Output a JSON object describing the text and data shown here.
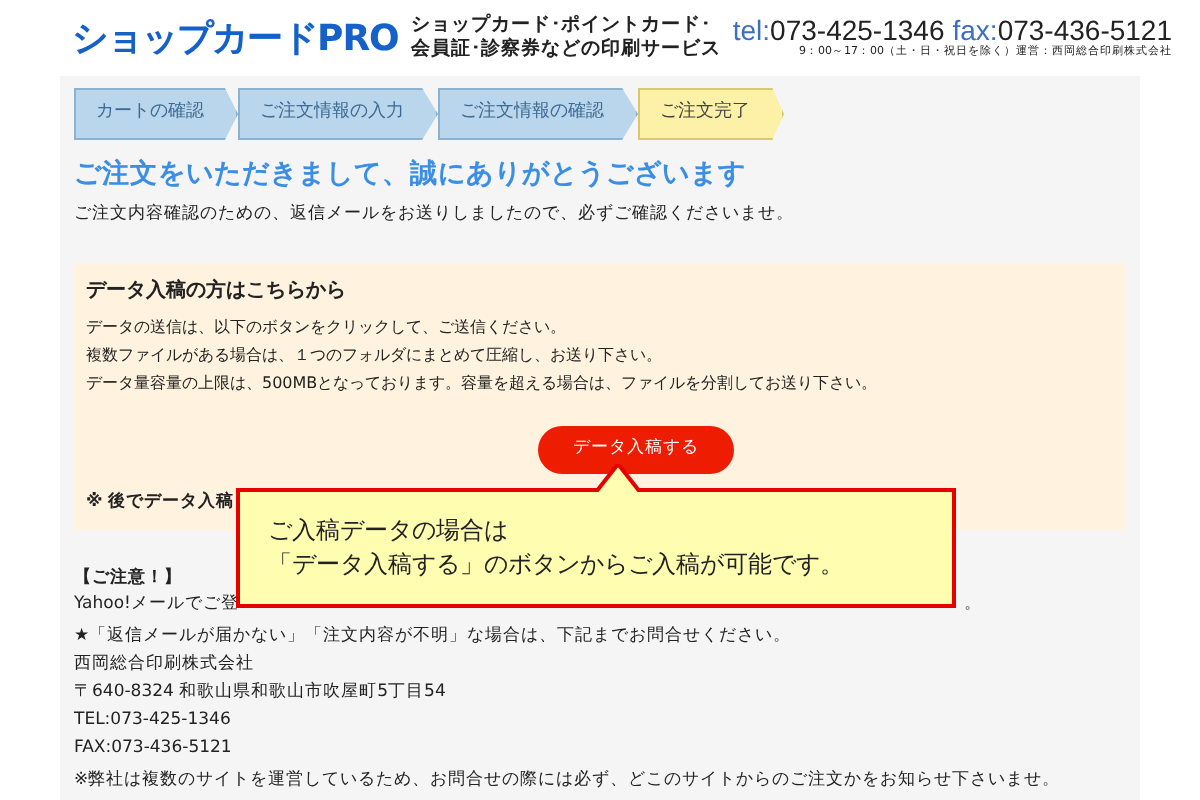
{
  "header": {
    "logo": "ショップカードPRO",
    "tagline_lines": [
      "ショップカード･ポイントカード･",
      "会員証･診察券などの印刷サービス"
    ],
    "tel_label": "tel:",
    "tel": "073-425-1346",
    "fax_label": "fax:",
    "fax": "073-436-5121",
    "hours": "9：00～17：00（土・日・祝日を除く）運営：西岡総合印刷株式会社"
  },
  "steps": [
    {
      "label": "カートの確認",
      "selected": false
    },
    {
      "label": "ご注文情報の入力",
      "selected": false
    },
    {
      "label": "ご注文情報の確認",
      "selected": false
    },
    {
      "label": "ご注文完了",
      "selected": true
    }
  ],
  "title": "ご注文をいただきまして、誠にありがとうございます",
  "intro": "ご注文内容確認のための、返信メールをお送りしましたので、必ずご確認くださいませ。",
  "upload": {
    "heading": "データ入稿の方はこちらから",
    "lines": [
      "データの送信は、以下のボタンをクリックして、ご送信ください。",
      "複数ファイルがある場合は、１つのフォルダにまとめて圧縮し、お送り下さい。",
      "データ量容量の上限は、500MBとなっております。容量を超える場合は、ファイルを分割してお送り下さい。"
    ],
    "button": "データ入稿する",
    "note": "※ 後でデータ入稿"
  },
  "caution": {
    "heading": "【ご注意！】",
    "line_start": "Yahoo!メールでご登",
    "line_end": "。"
  },
  "contact": {
    "lead": "★「返信メールが届かない」「注文内容が不明」な場合は、下記までお問合せください。",
    "lines": [
      "西岡総合印刷株式会社",
      "〒640-8324 和歌山県和歌山市吹屋町5丁目54",
      "TEL:073-425-1346",
      "FAX:073-436-5121"
    ]
  },
  "footer_note": "※弊社は複数のサイトを運営しているため、お問合せの際には必ず、どこのサイトからのご注文かをお知らせ下さいませ。",
  "callout": {
    "lines": [
      "ご入稿データの場合は",
      "「データ入稿する」のボタンからご入稿が可能です。"
    ]
  }
}
